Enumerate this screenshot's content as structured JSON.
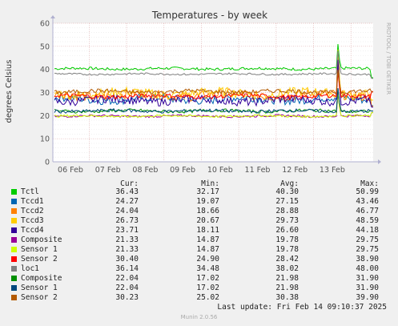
{
  "chart_data": {
    "type": "line",
    "title": "Temperatures - by week",
    "ylabel": "degrees Celsius",
    "watermark": "RRDTOOL / TOBI OETIKER",
    "ylim": [
      0,
      60
    ],
    "yticks": [
      0,
      10,
      20,
      30,
      40,
      50,
      60
    ],
    "xticks": [
      "06 Feb",
      "07 Feb",
      "08 Feb",
      "09 Feb",
      "10 Feb",
      "11 Feb",
      "12 Feb",
      "13 Feb"
    ],
    "grid": true,
    "series": [
      {
        "name": "Tctl",
        "color": "#00cc00",
        "cur": "36.43",
        "min": "32.17",
        "avg": "40.30",
        "max": "50.99",
        "base": 40.3,
        "noise": 0.6,
        "spike": 50.99,
        "end": 36.4
      },
      {
        "name": "Tccd1",
        "color": "#0066b3",
        "cur": "24.27",
        "min": "19.07",
        "avg": "27.15",
        "max": "43.46",
        "base": 27.1,
        "noise": 1.8,
        "spike": 43.46,
        "end": 24.3
      },
      {
        "name": "Tccd2",
        "color": "#ff8000",
        "cur": "24.04",
        "min": "18.66",
        "avg": "28.88",
        "max": "46.77",
        "base": 28.9,
        "noise": 2.0,
        "spike": 46.77,
        "end": 24.0
      },
      {
        "name": "Tccd3",
        "color": "#ffcc00",
        "cur": "26.73",
        "min": "20.67",
        "avg": "29.73",
        "max": "48.59",
        "base": 29.7,
        "noise": 2.0,
        "spike": 48.59,
        "end": 26.7
      },
      {
        "name": "Tccd4",
        "color": "#330099",
        "cur": "23.71",
        "min": "18.11",
        "avg": "26.60",
        "max": "44.18",
        "base": 26.6,
        "noise": 1.8,
        "spike": 44.18,
        "end": 23.7
      },
      {
        "name": "Composite",
        "color": "#990099",
        "cur": "21.33",
        "min": "14.87",
        "avg": "19.78",
        "max": "29.75",
        "base": 19.8,
        "noise": 0.5,
        "spike": 29.75,
        "end": 21.3
      },
      {
        "name": "Sensor 1",
        "color": "#ccff00",
        "cur": "21.33",
        "min": "14.87",
        "avg": "19.78",
        "max": "29.75",
        "base": 19.8,
        "noise": 0.5,
        "spike": 29.75,
        "end": 21.3
      },
      {
        "name": "Sensor 2",
        "color": "#ff0000",
        "cur": "30.40",
        "min": "24.90",
        "avg": "28.42",
        "max": "38.90",
        "base": 28.4,
        "noise": 0.9,
        "spike": 38.9,
        "end": 30.4
      },
      {
        "name": "loc1",
        "color": "#808080",
        "cur": "36.14",
        "min": "34.48",
        "avg": "38.02",
        "max": "48.00",
        "base": 38.0,
        "noise": 0.4,
        "spike": 48.0,
        "end": 36.1
      },
      {
        "name": "Composite",
        "color": "#008f00",
        "cur": "22.04",
        "min": "17.02",
        "avg": "21.98",
        "max": "31.90",
        "base": 22.0,
        "noise": 0.7,
        "spike": 31.9,
        "end": 22.0
      },
      {
        "name": "Sensor 1",
        "color": "#00487d",
        "cur": "22.04",
        "min": "17.02",
        "avg": "21.98",
        "max": "31.90",
        "base": 22.0,
        "noise": 0.7,
        "spike": 31.9,
        "end": 22.0
      },
      {
        "name": "Sensor 2",
        "color": "#b35a00",
        "cur": "30.23",
        "min": "25.02",
        "avg": "30.38",
        "max": "39.90",
        "base": 30.4,
        "noise": 0.9,
        "spike": 39.9,
        "end": 30.2
      }
    ]
  },
  "legend": {
    "headers": {
      "cur": "Cur:",
      "min": "Min:",
      "avg": "Avg:",
      "max": "Max:"
    }
  },
  "footer": {
    "last_update": "Last update: Fri Feb 14 09:10:37 2025",
    "version": "Munin 2.0.56"
  }
}
